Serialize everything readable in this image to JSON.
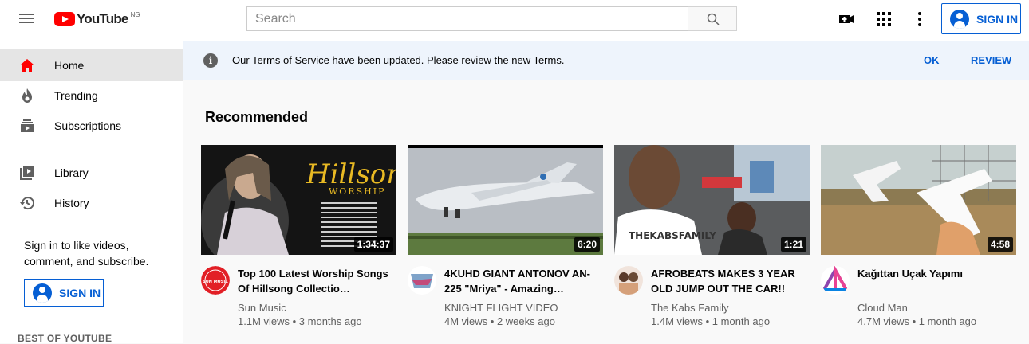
{
  "header": {
    "logo_text": "YouTube",
    "country_code": "NG",
    "search_placeholder": "Search",
    "signin_label": "SIGN IN"
  },
  "sidebar": {
    "items": [
      {
        "label": "Home",
        "icon": "home-icon"
      },
      {
        "label": "Trending",
        "icon": "trending-icon"
      },
      {
        "label": "Subscriptions",
        "icon": "subscriptions-icon"
      },
      {
        "label": "Library",
        "icon": "library-icon"
      },
      {
        "label": "History",
        "icon": "history-icon"
      }
    ],
    "promo_text": "Sign in to like videos, comment, and subscribe.",
    "signin_label": "SIGN IN",
    "best_of_label": "BEST OF YOUTUBE"
  },
  "banner": {
    "message": "Our Terms of Service have been updated. Please review the new Terms.",
    "ok_label": "OK",
    "review_label": "REVIEW"
  },
  "main": {
    "section_title": "Recommended",
    "videos": [
      {
        "title": "Top 100 Latest Worship Songs Of Hillsong Collectio…",
        "channel": "Sun Music",
        "stats": "1.1M views • 3 months ago",
        "duration": "1:34:37"
      },
      {
        "title": "4KUHD GIANT ANTONOV AN-225 \"Mriya\" - Amazing…",
        "channel": "KNIGHT FLIGHT VIDEO",
        "stats": "4M views • 2 weeks ago",
        "duration": "6:20"
      },
      {
        "title": "AFROBEATS MAKES 3 YEAR OLD JUMP OUT THE CAR!!",
        "channel": "The Kabs Family",
        "stats": "1.4M views • 1 month ago",
        "duration": "1:21"
      },
      {
        "title": "Kağıttan Uçak Yapımı",
        "channel": "Cloud Man",
        "stats": "4.7M views • 1 month ago",
        "duration": "4:58"
      }
    ],
    "thumb_overlay": {
      "hillsong_script": "Hillsong",
      "hillsong_sub": "WORSHIP",
      "kabs_shirt": "THEKABSFAMILY",
      "sun_music_logo": "SUN MUSIC"
    }
  },
  "colors": {
    "brand_red": "#ff0000",
    "link_blue": "#065fd4",
    "banner_bg": "#eef4fc"
  }
}
